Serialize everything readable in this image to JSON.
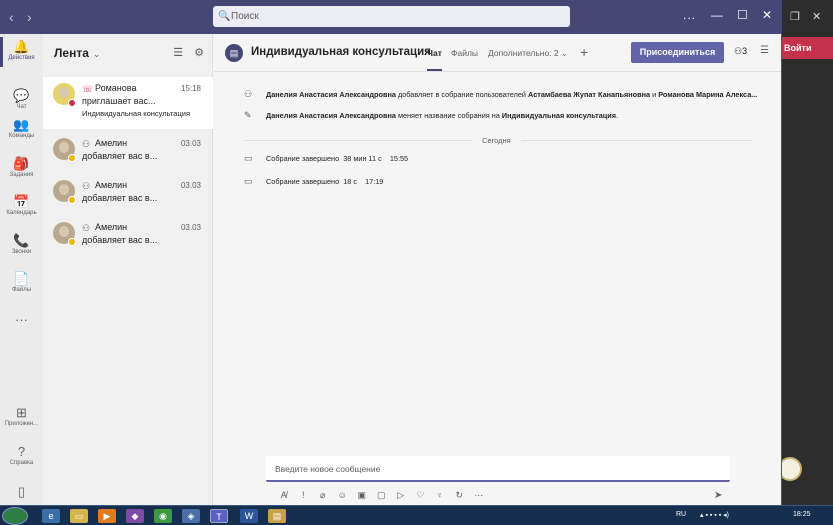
{
  "search": {
    "placeholder": "Поиск"
  },
  "titlebar": {
    "more": "...",
    "minimize": "—",
    "maximize": "☐",
    "close": "✕"
  },
  "bg_window": {
    "join_label": "Войти"
  },
  "rail": {
    "items": [
      {
        "label": "Действия",
        "icon": "bell-icon",
        "glyph": "🔔"
      },
      {
        "label": "Чат",
        "icon": "chat-icon",
        "glyph": "💬"
      },
      {
        "label": "Команды",
        "icon": "teams-icon",
        "glyph": "👥"
      },
      {
        "label": "Задания",
        "icon": "assignments-icon",
        "glyph": "🎒"
      },
      {
        "label": "Календарь",
        "icon": "calendar-icon",
        "glyph": "📅"
      },
      {
        "label": "Звонки",
        "icon": "phone-icon",
        "glyph": "📞"
      },
      {
        "label": "Файлы",
        "icon": "files-icon",
        "glyph": "📄"
      },
      {
        "label": "",
        "icon": "more-icon",
        "glyph": "···"
      },
      {
        "label": "Приложен...",
        "icon": "apps-icon",
        "glyph": "⊞"
      },
      {
        "label": "Справка",
        "icon": "help-icon",
        "glyph": "?"
      },
      {
        "label": "",
        "icon": "device-icon",
        "glyph": "▯"
      }
    ]
  },
  "feed": {
    "title": "Лента",
    "items": [
      {
        "name": "Романова",
        "line2": "приглашает вас...",
        "line3": "Индивидуальная консультация",
        "time": "15:18",
        "selected": true
      },
      {
        "name": "Амелин",
        "line2": "добавляет вас в...",
        "line3": "",
        "time": "03.03",
        "selected": false
      },
      {
        "name": "Амелин",
        "line2": "добавляет вас в...",
        "line3": "",
        "time": "03.03",
        "selected": false
      },
      {
        "name": "Амелин",
        "line2": "добавляет вас в...",
        "line3": "",
        "time": "03.03",
        "selected": false
      }
    ]
  },
  "main": {
    "title": "Индивидуальная консультация",
    "tabs": {
      "chat": "Чат",
      "files": "Файлы",
      "more": "Дополнительно: 2"
    },
    "join_label": "Присоединиться",
    "participants": "3",
    "messages": [
      {
        "actor": "Данелия Анастасия Александровна",
        "text": " добавляет в собрание пользователей ",
        "target": "Астамбаева Жупат Канапьяновна",
        "join": " и ",
        "target2": "Романова Марина Алекса..."
      },
      {
        "actor": "Данелия Анастасия Александровна",
        "text": " меняет название собрания на ",
        "target": "Индивидуальная консультация",
        "join": ".",
        "target2": ""
      }
    ],
    "divider": "Сегодня",
    "meetings": [
      {
        "text": "Собрание завершено",
        "duration": "38 мин 11 с",
        "time": "15:55"
      },
      {
        "text": "Собрание завершено",
        "duration": "18 с",
        "time": "17:19"
      }
    ],
    "composer_placeholder": "Введите новое сообщение"
  },
  "taskbar": {
    "lang": "RU",
    "clock": "18:25"
  }
}
